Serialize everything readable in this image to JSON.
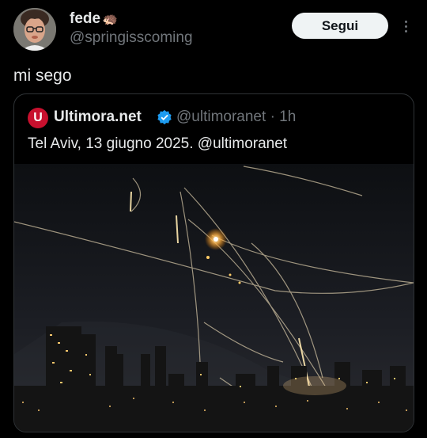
{
  "tweet": {
    "author_name": "fede",
    "author_emoji": "🦔",
    "author_handle": "@springisscoming",
    "follow_label": "Segui",
    "text": "mi sego"
  },
  "quoted": {
    "source_name": "Ultimora.net",
    "logo_letter": "U",
    "handle": "@ultimoranet",
    "separator": "·",
    "time": "1h",
    "text": "Tel Aviv, 13 giugno 2025. @ultimoranet"
  },
  "colors": {
    "background": "#000000",
    "text": "#e7e9ea",
    "muted": "#71767b",
    "border": "#2f3336",
    "brand": "#c8102e",
    "verified": "#1d9bf0"
  },
  "icons": [
    "avatar-photo",
    "hedgehog-emoji",
    "more-options-icon",
    "ultimora-logo",
    "verified-badge-icon"
  ]
}
